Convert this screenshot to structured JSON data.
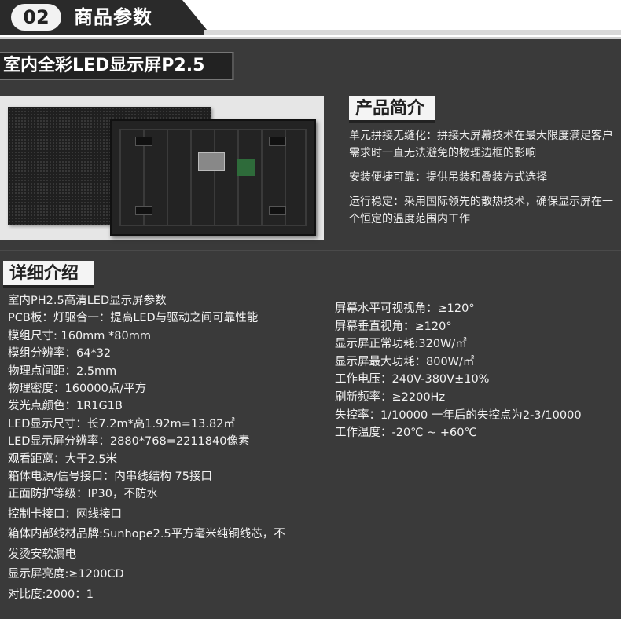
{
  "header": {
    "number": "02",
    "title": "商品参数"
  },
  "product_title": "室内全彩LED显示屏P2.5",
  "intro": {
    "heading": "产品简介",
    "items": [
      "单元拼接无缝化：拼接大屏幕技术在最大限度满足客户需求时一直无法避免的物理边框的影响",
      "安装便捷可靠：提供吊装和叠装方式选择",
      "运行稳定：采用国际领先的散热技术，确保显示屏在一个恒定的温度范围内工作"
    ]
  },
  "details": {
    "heading": "详细介绍",
    "left": [
      "室内PH2.5高清LED显示屏参数",
      "PCB板：灯驱合一：提高LED与驱动之间可靠性能",
      "模组尺寸: 160mm *80mm",
      "模组分辨率：64*32",
      "物理点间距：2.5mm",
      "物理密度：160000点/平方",
      "发光点颜色：1R1G1B",
      "LED显示尺寸：长7.2m*高1.92m=13.82㎡",
      "LED显示屏分辨率：2880*768=2211840像素",
      "观看距离：大于2.5米",
      "箱体电源/信号接口：内串线结构  75接口",
      "正面防护等级：IP30，不防水",
      "控制卡接口：网线接口",
      "箱体内部线材品牌:Sunhope2.5平方毫米纯铜线芯，不",
      "发烫安软漏电",
      "显示屏亮度:≥1200CD",
      "对比度:2000：1"
    ],
    "right": [
      "屏幕水平可视视角：≥120°",
      "屏幕垂直视角：≥120°",
      "显示屏正常功耗:320W/㎡",
      "显示屏最大功耗：800W/㎡",
      "工作电压：240V-380V±10%",
      "刷新频率：≥2200Hz",
      "失控率：1/10000   一年后的失控点为2-3/10000",
      "工作温度：-20℃ ~ +60℃"
    ]
  }
}
